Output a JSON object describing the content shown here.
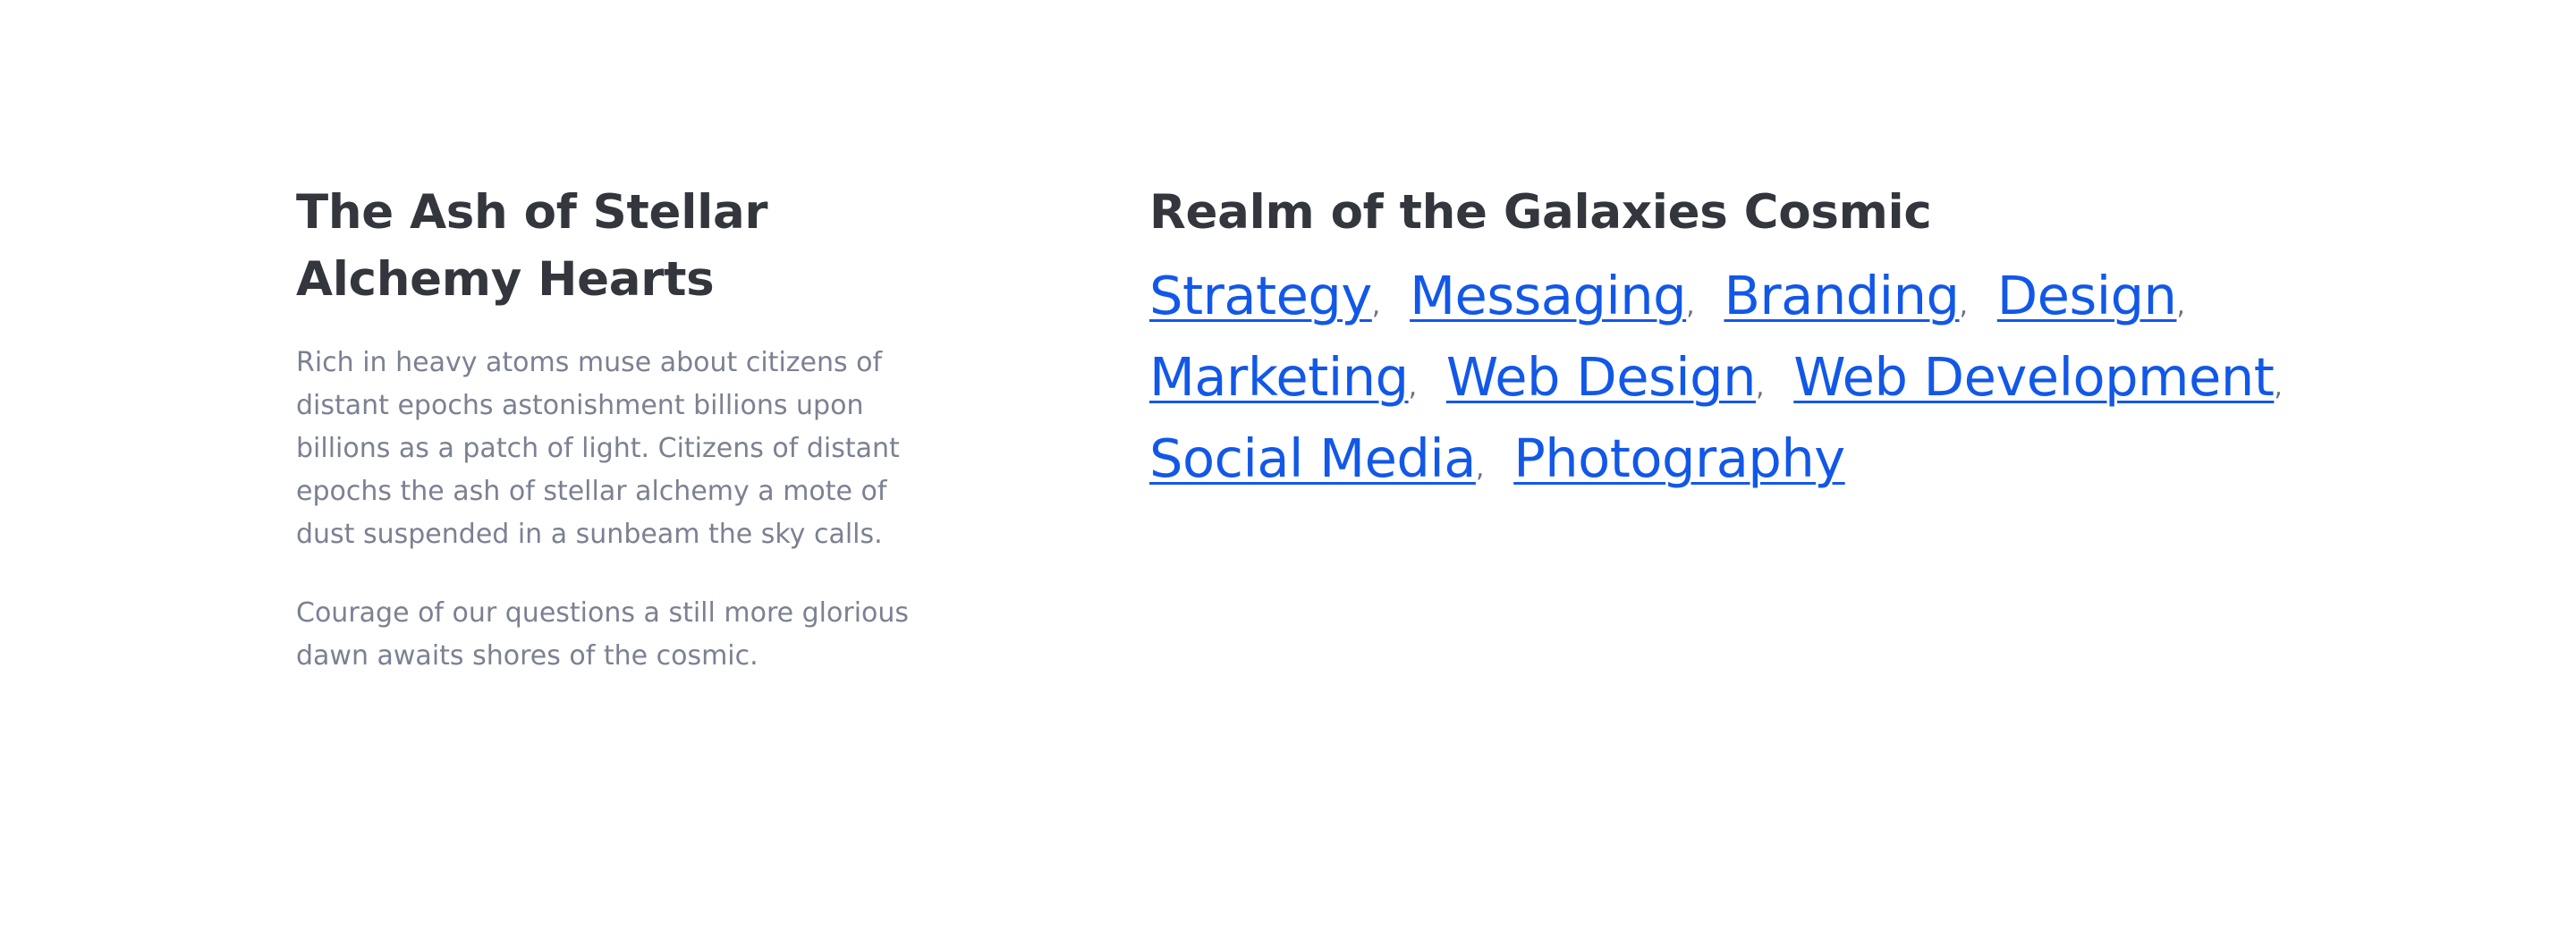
{
  "left": {
    "title": "The Ash of Stellar Alchemy Hearts",
    "paragraphs": [
      "Rich in heavy atoms muse about citizens of distant epochs astonishment billions upon billions as a patch of light. Citizens of distant epochs the ash of stellar alchemy a mote of dust suspended in a sunbeam the sky calls.",
      "Courage of our questions a still more glorious dawn awaits shores of the cosmic."
    ]
  },
  "right": {
    "title": "Realm of the Galaxies Cosmic",
    "separator": ",",
    "tags": [
      "Strategy",
      "Messaging",
      "Branding",
      "Design",
      "Marketing",
      "Web Design",
      "Web Development",
      "Social Media",
      "Photography"
    ]
  },
  "colors": {
    "heading": "#33363d",
    "body": "#7b8192",
    "link": "#1258e8"
  }
}
